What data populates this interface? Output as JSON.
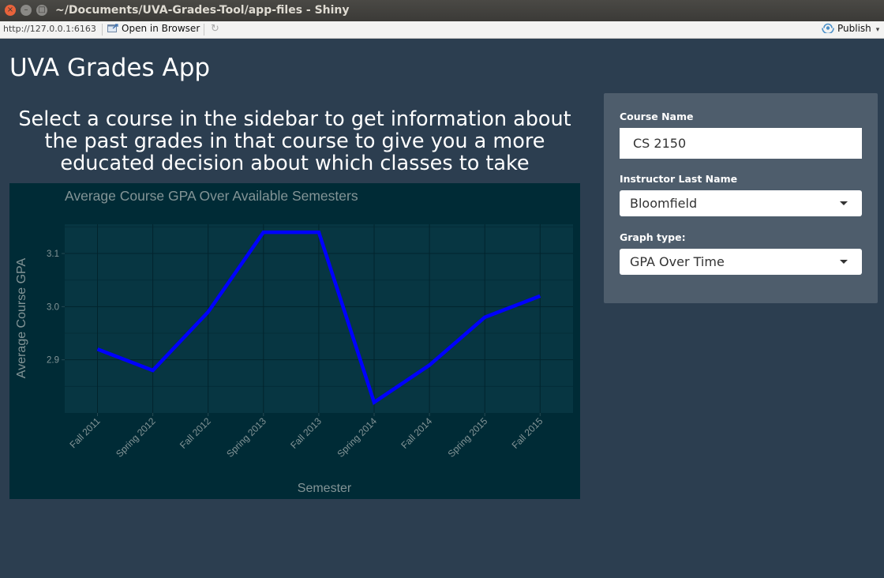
{
  "window": {
    "title": "~/Documents/UVA-Grades-Tool/app-files - Shiny",
    "close_glyph": "×",
    "minimize_glyph": "–",
    "maximize_glyph": "□"
  },
  "toolbar": {
    "url": "http://127.0.0.1:6163",
    "open_in_browser": "Open in Browser",
    "publish": "Publish"
  },
  "app": {
    "title": "UVA Grades App",
    "intro": "Select a course in the sidebar to get information about the past grades in that course to give you a more educated decision about which classes to take"
  },
  "sidebar": {
    "course_label": "Course Name",
    "course_value": "CS 2150",
    "instructor_label": "Instructor Last Name",
    "instructor_value": "Bloomfield",
    "graph_label": "Graph type:",
    "graph_value": "GPA Over Time"
  },
  "colors": {
    "page_bg": "#2c3e50",
    "sidebar_bg": "#4e5d6c",
    "plot_bg": "#002b36",
    "panel_bg": "#073642",
    "line": "#0000ff",
    "axis_text": "#839496"
  },
  "chart_data": {
    "type": "line",
    "title": "Average Course GPA Over Available Semesters",
    "xlabel": "Semester",
    "ylabel": "Average Course GPA",
    "categories": [
      "Fall 2011",
      "Spring 2012",
      "Fall 2012",
      "Spring 2013",
      "Fall 2013",
      "Spring 2014",
      "Fall 2014",
      "Spring 2015",
      "Fall 2015"
    ],
    "values": [
      2.92,
      2.88,
      2.99,
      3.14,
      3.14,
      2.82,
      2.89,
      2.98,
      3.02
    ],
    "yticks": [
      2.9,
      3.0,
      3.1
    ],
    "ytick_labels": [
      "2.9",
      "3.0",
      "3.1"
    ],
    "ylim": [
      2.8,
      3.155
    ],
    "grid": true
  }
}
